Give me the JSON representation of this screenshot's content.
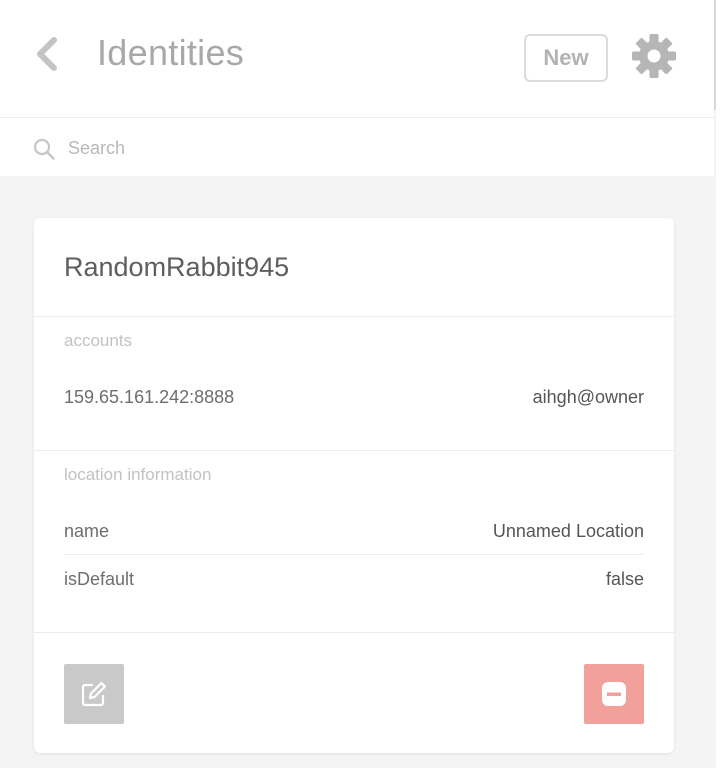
{
  "header": {
    "title": "Identities",
    "new_label": "New"
  },
  "search": {
    "placeholder": "Search",
    "value": ""
  },
  "identity": {
    "name": "RandomRabbit945",
    "accounts_label": "accounts",
    "accounts": [
      {
        "address": "159.65.161.242:8888",
        "user": "aihgh@owner"
      }
    ],
    "location_label": "location information",
    "location": [
      {
        "key": "name",
        "value": "Unnamed Location"
      },
      {
        "key": "isDefault",
        "value": "false"
      }
    ]
  },
  "colors": {
    "delete": "#f1a19a",
    "edit": "#c9c9c9",
    "header_text": "#a8a8a8"
  },
  "icons": [
    "back-chevron-icon",
    "gear-icon",
    "search-icon",
    "edit-icon",
    "remove-icon"
  ]
}
